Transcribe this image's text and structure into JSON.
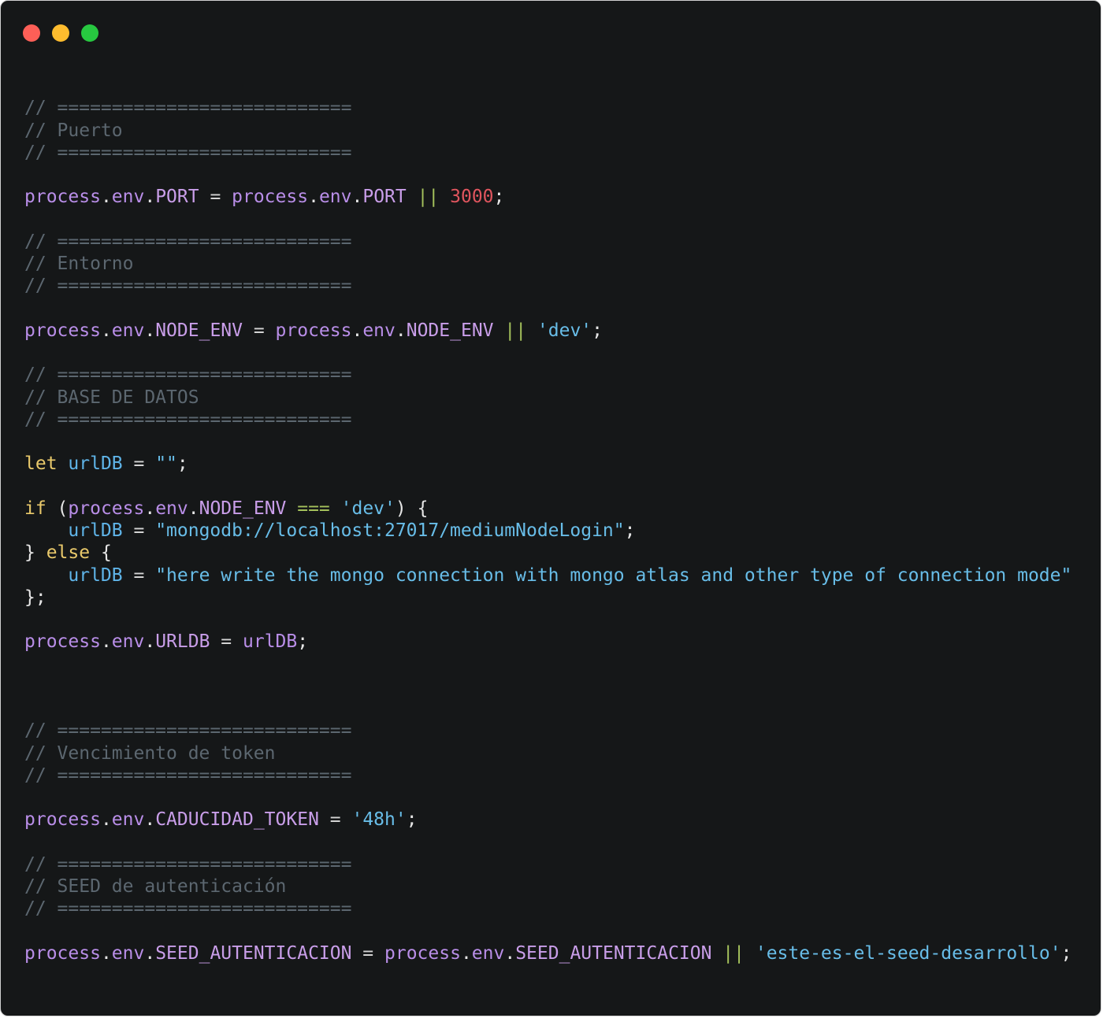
{
  "window": {
    "controls": [
      {
        "name": "close",
        "color": "#fd5f57"
      },
      {
        "name": "minimize",
        "color": "#febc2e"
      },
      {
        "name": "maximize",
        "color": "#27c840"
      }
    ]
  },
  "colors": {
    "comment": "#5c6770",
    "variable": "#b98ee8",
    "property": "#c99ee9",
    "operator": "#a5c25c",
    "plain": "#e6e6e6",
    "number": "#e0555e",
    "string": "#68bde8",
    "keyword": "#e9c96b",
    "identifier": "#5fb4e8",
    "equals": "#d4d4d4"
  },
  "code_lines": [
    [],
    [
      {
        "t": "// ===========================",
        "c": "comment"
      }
    ],
    [
      {
        "t": "// Puerto",
        "c": "comment"
      }
    ],
    [
      {
        "t": "// ===========================",
        "c": "comment"
      }
    ],
    [],
    [
      {
        "t": "process",
        "c": "variable"
      },
      {
        "t": ".",
        "c": "plain"
      },
      {
        "t": "env",
        "c": "variable"
      },
      {
        "t": ".",
        "c": "plain"
      },
      {
        "t": "PORT",
        "c": "property"
      },
      {
        "t": " = ",
        "c": "equals"
      },
      {
        "t": "process",
        "c": "variable"
      },
      {
        "t": ".",
        "c": "plain"
      },
      {
        "t": "env",
        "c": "variable"
      },
      {
        "t": ".",
        "c": "plain"
      },
      {
        "t": "PORT",
        "c": "property"
      },
      {
        "t": " || ",
        "c": "operator"
      },
      {
        "t": "3000",
        "c": "number"
      },
      {
        "t": ";",
        "c": "plain"
      }
    ],
    [],
    [
      {
        "t": "// ===========================",
        "c": "comment"
      }
    ],
    [
      {
        "t": "// Entorno",
        "c": "comment"
      }
    ],
    [
      {
        "t": "// ===========================",
        "c": "comment"
      }
    ],
    [],
    [
      {
        "t": "process",
        "c": "variable"
      },
      {
        "t": ".",
        "c": "plain"
      },
      {
        "t": "env",
        "c": "variable"
      },
      {
        "t": ".",
        "c": "plain"
      },
      {
        "t": "NODE_ENV",
        "c": "property"
      },
      {
        "t": " = ",
        "c": "equals"
      },
      {
        "t": "process",
        "c": "variable"
      },
      {
        "t": ".",
        "c": "plain"
      },
      {
        "t": "env",
        "c": "variable"
      },
      {
        "t": ".",
        "c": "plain"
      },
      {
        "t": "NODE_ENV",
        "c": "property"
      },
      {
        "t": " || ",
        "c": "operator"
      },
      {
        "t": "'dev'",
        "c": "string"
      },
      {
        "t": ";",
        "c": "plain"
      }
    ],
    [],
    [
      {
        "t": "// ===========================",
        "c": "comment"
      }
    ],
    [
      {
        "t": "// BASE DE DATOS",
        "c": "comment"
      }
    ],
    [
      {
        "t": "// ===========================",
        "c": "comment"
      }
    ],
    [],
    [
      {
        "t": "let",
        "c": "keyword"
      },
      {
        "t": " ",
        "c": "plain"
      },
      {
        "t": "urlDB",
        "c": "identifier"
      },
      {
        "t": " = ",
        "c": "equals"
      },
      {
        "t": "\"\"",
        "c": "string"
      },
      {
        "t": ";",
        "c": "plain"
      }
    ],
    [],
    [
      {
        "t": "if",
        "c": "keyword"
      },
      {
        "t": " (",
        "c": "plain"
      },
      {
        "t": "process",
        "c": "variable"
      },
      {
        "t": ".",
        "c": "plain"
      },
      {
        "t": "env",
        "c": "variable"
      },
      {
        "t": ".",
        "c": "plain"
      },
      {
        "t": "NODE_ENV",
        "c": "property"
      },
      {
        "t": " === ",
        "c": "operator"
      },
      {
        "t": "'dev'",
        "c": "string"
      },
      {
        "t": ") {",
        "c": "plain"
      }
    ],
    [
      {
        "t": "    ",
        "c": "plain"
      },
      {
        "t": "urlDB",
        "c": "identifier"
      },
      {
        "t": " = ",
        "c": "equals"
      },
      {
        "t": "\"mongodb://localhost:27017/mediumNodeLogin\"",
        "c": "string"
      },
      {
        "t": ";",
        "c": "plain"
      }
    ],
    [
      {
        "t": "} ",
        "c": "plain"
      },
      {
        "t": "else",
        "c": "keyword"
      },
      {
        "t": " {",
        "c": "plain"
      }
    ],
    [
      {
        "t": "    ",
        "c": "plain"
      },
      {
        "t": "urlDB",
        "c": "identifier"
      },
      {
        "t": " = ",
        "c": "equals"
      },
      {
        "t": "\"here write the mongo connection with mongo atlas and other type of connection mode\"",
        "c": "string"
      }
    ],
    [
      {
        "t": "};",
        "c": "plain"
      }
    ],
    [],
    [
      {
        "t": "process",
        "c": "variable"
      },
      {
        "t": ".",
        "c": "plain"
      },
      {
        "t": "env",
        "c": "variable"
      },
      {
        "t": ".",
        "c": "plain"
      },
      {
        "t": "URLDB",
        "c": "property"
      },
      {
        "t": " = ",
        "c": "equals"
      },
      {
        "t": "urlDB",
        "c": "variable"
      },
      {
        "t": ";",
        "c": "plain"
      }
    ],
    [],
    [],
    [],
    [
      {
        "t": "// ===========================",
        "c": "comment"
      }
    ],
    [
      {
        "t": "// Vencimiento de token",
        "c": "comment"
      }
    ],
    [
      {
        "t": "// ===========================",
        "c": "comment"
      }
    ],
    [],
    [
      {
        "t": "process",
        "c": "variable"
      },
      {
        "t": ".",
        "c": "plain"
      },
      {
        "t": "env",
        "c": "variable"
      },
      {
        "t": ".",
        "c": "plain"
      },
      {
        "t": "CADUCIDAD_TOKEN",
        "c": "property"
      },
      {
        "t": " = ",
        "c": "equals"
      },
      {
        "t": "'48h'",
        "c": "string"
      },
      {
        "t": ";",
        "c": "plain"
      }
    ],
    [],
    [
      {
        "t": "// ===========================",
        "c": "comment"
      }
    ],
    [
      {
        "t": "// SEED de autenticación",
        "c": "comment"
      }
    ],
    [
      {
        "t": "// ===========================",
        "c": "comment"
      }
    ],
    [],
    [
      {
        "t": "process",
        "c": "variable"
      },
      {
        "t": ".",
        "c": "plain"
      },
      {
        "t": "env",
        "c": "variable"
      },
      {
        "t": ".",
        "c": "plain"
      },
      {
        "t": "SEED_AUTENTICACION",
        "c": "property"
      },
      {
        "t": " = ",
        "c": "equals"
      },
      {
        "t": "process",
        "c": "variable"
      },
      {
        "t": ".",
        "c": "plain"
      },
      {
        "t": "env",
        "c": "variable"
      },
      {
        "t": ".",
        "c": "plain"
      },
      {
        "t": "SEED_AUTENTICACION",
        "c": "property"
      },
      {
        "t": " || ",
        "c": "operator"
      },
      {
        "t": "'este-es-el-seed-desarrollo'",
        "c": "string"
      },
      {
        "t": ";",
        "c": "plain"
      }
    ]
  ]
}
